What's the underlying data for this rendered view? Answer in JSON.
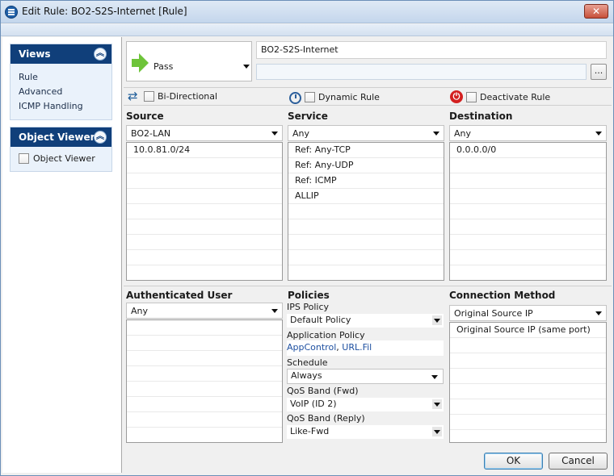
{
  "window": {
    "title": "Edit Rule: BO2-S2S-Internet [Rule]",
    "close_label": "✕"
  },
  "left": {
    "views": {
      "header": "Views",
      "items": [
        "Rule",
        "Advanced",
        "ICMP Handling"
      ]
    },
    "object_viewer": {
      "header": "Object Viewer",
      "checkbox_label": "Object Viewer"
    }
  },
  "rule": {
    "action": "Pass",
    "name": "BO2-S2S-Internet",
    "comment": "",
    "ellipsis": "...",
    "options": {
      "bidirectional": "Bi-Directional",
      "dynamic": "Dynamic Rule",
      "deactivate": "Deactivate Rule"
    }
  },
  "source": {
    "title": "Source",
    "selected": "BO2-LAN",
    "items": [
      "10.0.81.0/24"
    ]
  },
  "service": {
    "title": "Service",
    "selected": "Any",
    "items": [
      "Ref: Any-TCP",
      "Ref: Any-UDP",
      "Ref: ICMP",
      "ALLIP"
    ]
  },
  "destination": {
    "title": "Destination",
    "selected": "Any",
    "items": [
      "0.0.0.0/0"
    ]
  },
  "auth_user": {
    "title": "Authenticated User",
    "selected": "Any"
  },
  "policies": {
    "title": "Policies",
    "ips_label": "IPS Policy",
    "ips_value": "Default Policy",
    "app_label": "Application Policy",
    "app_value_1": "AppControl",
    "app_sep": ", ",
    "app_value_2": "URL.Fil",
    "schedule_label": "Schedule",
    "schedule_value": "Always",
    "qos_fwd_label": "QoS Band (Fwd)",
    "qos_fwd_value": "VoIP (ID 2)",
    "qos_reply_label": "QoS Band (Reply)",
    "qos_reply_value": "Like-Fwd"
  },
  "connection": {
    "title": "Connection Method",
    "selected": "Original Source IP",
    "items": [
      "Original Source IP (same port)"
    ]
  },
  "buttons": {
    "ok": "OK",
    "cancel": "Cancel"
  }
}
